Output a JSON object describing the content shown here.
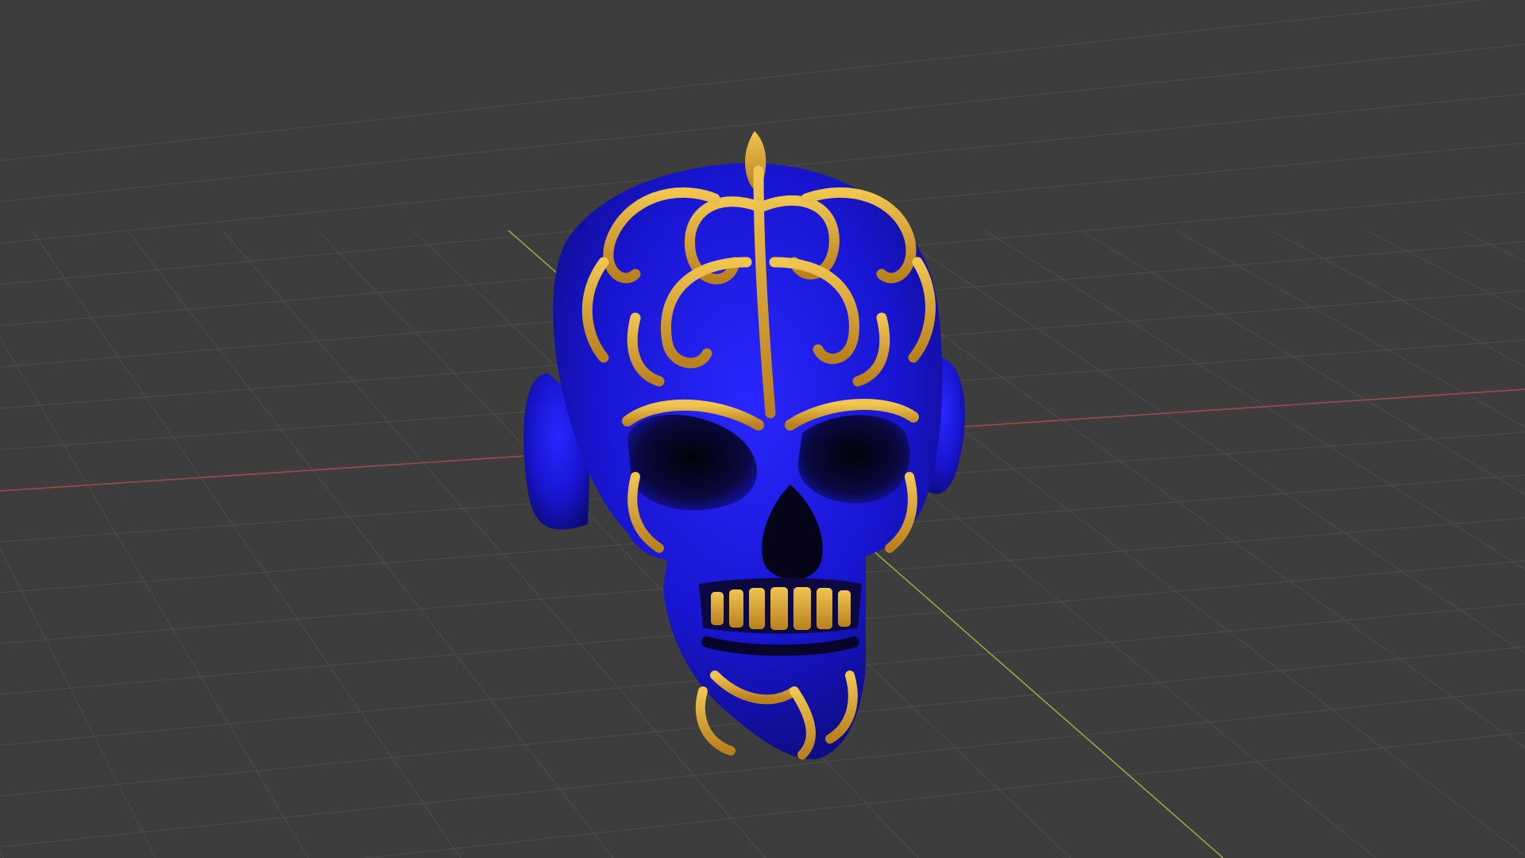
{
  "viewport": {
    "background_color": "#3d3d3d",
    "grid_line_color": "#4a4a4a",
    "x_axis_color": "#9c4a4a",
    "y_axis_color": "#8bb03a"
  },
  "model": {
    "name": "",
    "base_color": "#1a17d8",
    "ornament_color": "#d8a532",
    "shadow_color": "#070620",
    "icon": "ornate-skull-model"
  }
}
